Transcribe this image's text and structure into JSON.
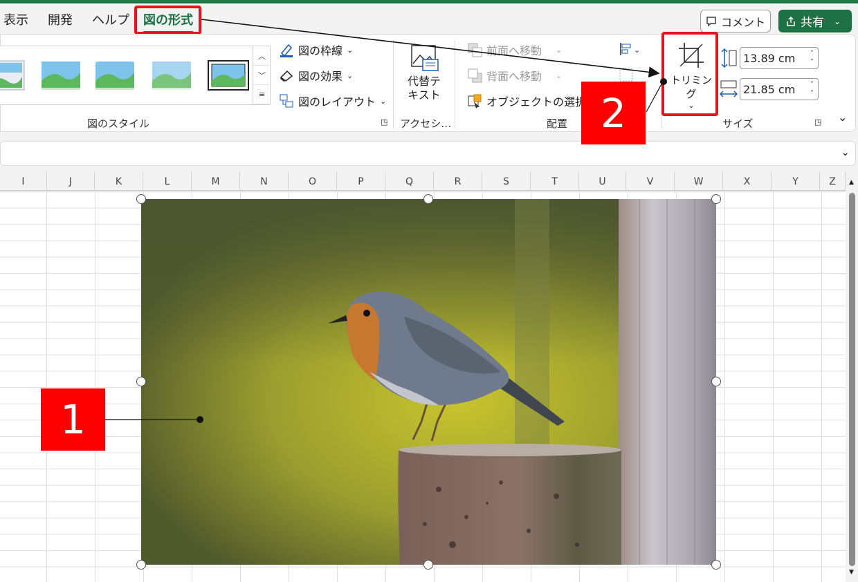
{
  "tabs": [
    "表示",
    "開発",
    "ヘルプ",
    "図の形式"
  ],
  "header": {
    "comment_label": "コメント",
    "share_label": "共有"
  },
  "ribbon": {
    "picture_styles_label": "図のスタイル",
    "border_label": "図の枠線",
    "effects_label": "図の効果",
    "layout_label": "図のレイアウト",
    "alt_text_label_line1": "代替テ",
    "alt_text_label_line2": "キスト",
    "accessibility_label": "アクセシ…",
    "bring_forward_label": "前面へ移動",
    "send_backward_label": "背面へ移動",
    "selection_pane_label": "オブジェクトの選択と",
    "arrange_label": "配置",
    "crop_label": "トリミング",
    "height_value": "13.89 cm",
    "width_value": "21.85 cm",
    "size_label": "サイズ"
  },
  "columns": [
    "I",
    "J",
    "K",
    "L",
    "M",
    "N",
    "O",
    "P",
    "Q",
    "R",
    "S",
    "T",
    "U",
    "V",
    "W",
    "X",
    "Y",
    "Z"
  ],
  "callouts": {
    "one": "1",
    "two": "2"
  },
  "colors": {
    "accent": "#1e7145",
    "highlight": "#e8141c",
    "callout": "#ff0000"
  }
}
